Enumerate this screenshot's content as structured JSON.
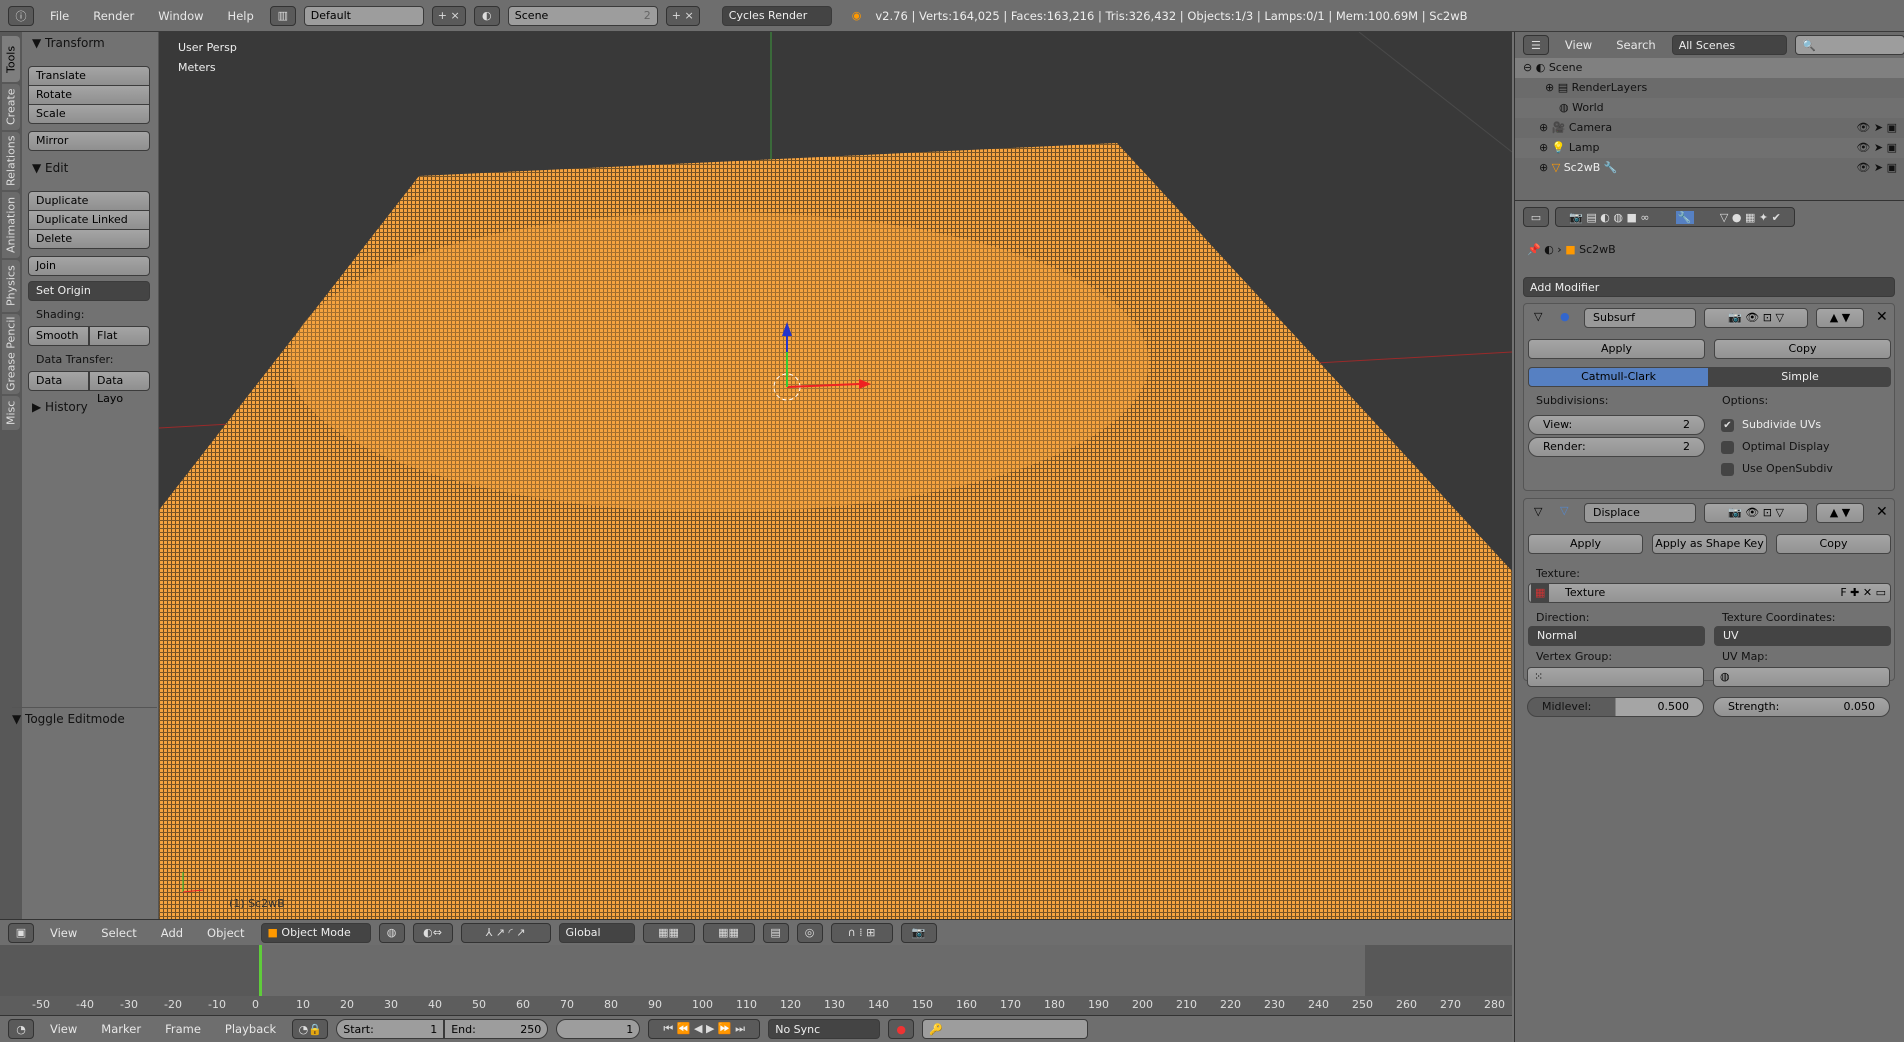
{
  "topbar": {
    "menus": [
      "File",
      "Render",
      "Window",
      "Help"
    ],
    "layout": "Default",
    "scene": "Scene",
    "scene_users": "2",
    "engine": "Cycles Render",
    "stats": "v2.76 | Verts:164,025 | Faces:163,216 | Tris:326,432 | Objects:1/3 | Lamps:0/1 | Mem:100.69M | Sc2wB"
  },
  "tool_tabs": [
    "Tools",
    "Create",
    "Relations",
    "Animation",
    "Physics",
    "Grease Pencil",
    "Misc"
  ],
  "tools": {
    "transform": "Transform",
    "translate": "Translate",
    "rotate": "Rotate",
    "scale": "Scale",
    "mirror": "Mirror",
    "edit": "Edit",
    "duplicate": "Duplicate",
    "duplicate_linked": "Duplicate Linked",
    "delete": "Delete",
    "join": "Join",
    "set_origin": "Set Origin",
    "shading": "Shading:",
    "smooth": "Smooth",
    "flat": "Flat",
    "data_transfer": "Data Transfer:",
    "data": "Data",
    "data_layo": "Data Layo",
    "history": "History",
    "toggle_editmode": "Toggle Editmode"
  },
  "viewport": {
    "view_name": "User Persp",
    "units": "Meters",
    "object_label": "(1) Sc2wB",
    "mesh_color": "#f5a340"
  },
  "view3d_header": {
    "menus": [
      "View",
      "Select",
      "Add",
      "Object"
    ],
    "mode": "Object Mode",
    "orientation": "Global"
  },
  "timeline": {
    "ruler": [
      -50,
      -40,
      -30,
      -20,
      -10,
      0,
      10,
      20,
      30,
      40,
      50,
      60,
      70,
      80,
      90,
      100,
      110,
      120,
      130,
      140,
      150,
      160,
      170,
      180,
      190,
      200,
      210,
      220,
      230,
      240,
      250,
      260,
      270,
      280
    ],
    "current_frame": 1,
    "menus": [
      "View",
      "Marker",
      "Frame",
      "Playback"
    ],
    "start_label": "Start:",
    "start": "1",
    "end_label": "End:",
    "end": "250",
    "frame": "1",
    "sync": "No Sync"
  },
  "outliner": {
    "menus": [
      "View",
      "Search"
    ],
    "filter": "All Scenes",
    "items": [
      "Scene",
      "RenderLayers",
      "World",
      "Camera",
      "Lamp",
      "Sc2wB"
    ]
  },
  "properties": {
    "breadcrumb": "Sc2wB",
    "add_modifier": "Add Modifier",
    "subsurf": {
      "name": "Subsurf",
      "apply": "Apply",
      "copy": "Copy",
      "catmull": "Catmull-Clark",
      "simple": "Simple",
      "subdivisions": "Subdivisions:",
      "view_label": "View:",
      "view": "2",
      "render_label": "Render:",
      "render": "2",
      "options": "Options:",
      "subdivide_uvs": "Subdivide UVs",
      "optimal_display": "Optimal Display",
      "use_opensubdiv": "Use OpenSubdiv"
    },
    "displace": {
      "name": "Displace",
      "apply": "Apply",
      "apply_shape": "Apply as Shape Key",
      "copy": "Copy",
      "texture_label": "Texture:",
      "texture": "Texture",
      "f": "F",
      "direction_label": "Direction:",
      "direction": "Normal",
      "coords_label": "Texture Coordinates:",
      "coords": "UV",
      "vgroup_label": "Vertex Group:",
      "uvmap_label": "UV Map:",
      "midlevel_label": "Midlevel:",
      "midlevel": "0.500",
      "midlevel_fraction": 0.5,
      "strength_label": "Strength:",
      "strength": "0.050"
    }
  }
}
